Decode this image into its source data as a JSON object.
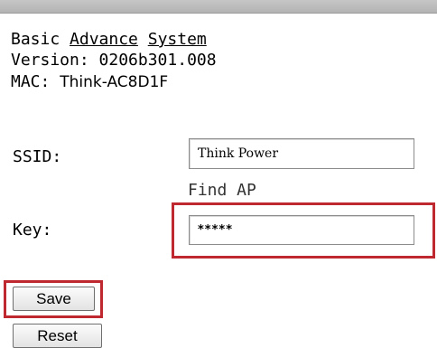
{
  "nav": {
    "basic": "Basic",
    "advance": "Advance",
    "system": "System"
  },
  "info": {
    "version": "Version: 0206b301.008",
    "mac_label": "MAC:",
    "mac_value": "Think-AC8D1F"
  },
  "form": {
    "ssid_label": "SSID:",
    "ssid_value": "Think Power",
    "find_ap": "Find AP",
    "key_label": "Key:",
    "key_value": "*****"
  },
  "buttons": {
    "save": "Save",
    "reset": "Reset"
  },
  "colors": {
    "highlight": "#c0282f",
    "top_bar": "#bdbdbd"
  }
}
